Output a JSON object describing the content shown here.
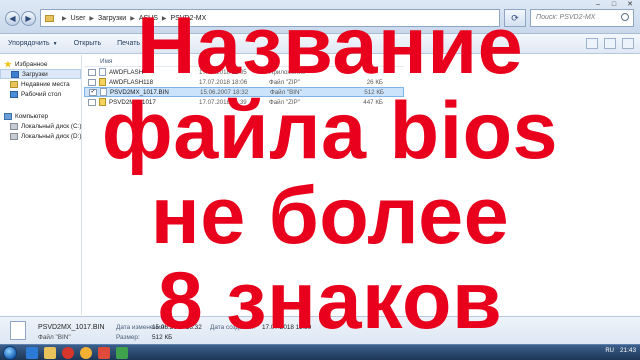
{
  "window": {
    "controls": [
      "–",
      "□",
      "✕"
    ]
  },
  "addressbar": {
    "crumbs": [
      "User",
      "Загрузки",
      "ASUS",
      "PSVD2-MX"
    ],
    "search_placeholder": "Поиск: PSVD2-MX"
  },
  "toolbar": {
    "organize_label": "Упорядочить",
    "open_label": "Открыть",
    "print_label": "Печать"
  },
  "navpane": {
    "items": [
      {
        "label": "Избранное",
        "icon": "star-icon"
      },
      {
        "label": "Загрузки",
        "icon": "downloads-icon"
      },
      {
        "label": "Недавние места",
        "icon": "recent-places-icon"
      },
      {
        "label": "Рабочий стол",
        "icon": "desktop-icon"
      },
      {
        "label": "Компьютер",
        "icon": "computer-icon"
      },
      {
        "label": "Локальный диск (C:)",
        "icon": "disk-icon"
      },
      {
        "label": "Локальный диск (D:)",
        "icon": "disk-icon"
      }
    ]
  },
  "filelist": {
    "column_name": "Имя",
    "rows": [
      {
        "name": "AWDFLASH",
        "date": "17.07.2018 11:05",
        "type": "Приложение",
        "size": "",
        "icon": "app-file-icon"
      },
      {
        "name": "AWDFLASH118",
        "date": "17.07.2018 18:06",
        "type": "Файл \"ZIP\"",
        "size": "26 КБ",
        "icon": "zip-file-icon"
      },
      {
        "name": "PSVD2MX_1017.BIN",
        "date": "15.06.2007 18:32",
        "type": "Файл \"BIN\"",
        "size": "512 КБ",
        "icon": "bin-file-icon",
        "selected": true
      },
      {
        "name": "PSVD2MX_1017",
        "date": "17.07.2018 11:39",
        "type": "Файл \"ZIP\"",
        "size": "447 КБ",
        "icon": "zip-file-icon"
      }
    ]
  },
  "details": {
    "name": "PSVD2MX_1017.BIN",
    "type": "Файл \"BIN\"",
    "k_modified": "Дата изменения:",
    "v_modified": "15.06.2007 18:32",
    "k_created": "Дата создания:",
    "v_created": "17.07.2018 11:39",
    "k_size": "Размер:",
    "v_size": "512 КБ"
  },
  "taskbar": {
    "lang": "RU",
    "time": "21:43"
  },
  "caption": {
    "lines": [
      "Название",
      "файла bios",
      "не более",
      "8 знаков"
    ],
    "color": "#e8001c"
  }
}
